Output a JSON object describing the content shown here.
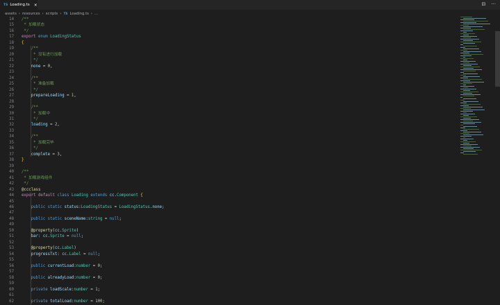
{
  "tab": {
    "badge": "TS",
    "label": "Loading.ts",
    "close": "×"
  },
  "actions": {
    "split": "⊟",
    "more": "···"
  },
  "breadcrumb": [
    "assets",
    "resources",
    "scripts"
  ],
  "breadcrumb_file": {
    "badge": "TS",
    "label": "Loading.ts",
    "more": "..."
  },
  "breadcrumb_sep": "›",
  "code": [
    {
      "n": "14",
      "t": [
        [
          "cm",
          "/**"
        ]
      ]
    },
    {
      "n": "15",
      "t": [
        [
          "cm",
          " * 加载状态"
        ]
      ]
    },
    {
      "n": "16",
      "t": [
        [
          "cm",
          " */"
        ]
      ]
    },
    {
      "n": "17",
      "t": [
        [
          "ctl",
          "export "
        ],
        [
          "kw",
          "enum "
        ],
        [
          "ty",
          "LoadingStatus"
        ]
      ]
    },
    {
      "n": "18",
      "t": [
        [
          "br",
          "{"
        ]
      ]
    },
    {
      "n": "19",
      "t": [
        [
          "cm",
          "    /**"
        ]
      ]
    },
    {
      "n": "20",
      "t": [
        [
          "cm",
          "     * 没有进行加载"
        ]
      ]
    },
    {
      "n": "21",
      "t": [
        [
          "cm",
          "     */"
        ]
      ]
    },
    {
      "n": "22",
      "t": [
        [
          "vr",
          "    none"
        ],
        [
          "pu",
          " = "
        ],
        [
          "nm",
          "0"
        ],
        [
          "pu",
          ","
        ]
      ]
    },
    {
      "n": "23",
      "t": []
    },
    {
      "n": "24",
      "t": [
        [
          "cm",
          "    /**"
        ]
      ]
    },
    {
      "n": "25",
      "t": [
        [
          "cm",
          "     * 准备加载"
        ]
      ]
    },
    {
      "n": "26",
      "t": [
        [
          "cm",
          "     */"
        ]
      ]
    },
    {
      "n": "27",
      "t": [
        [
          "vr",
          "    prepareLoading"
        ],
        [
          "pu",
          " = "
        ],
        [
          "nm",
          "1"
        ],
        [
          "pu",
          ","
        ]
      ]
    },
    {
      "n": "28",
      "t": []
    },
    {
      "n": "29",
      "t": [
        [
          "cm",
          "    /**"
        ]
      ]
    },
    {
      "n": "30",
      "t": [
        [
          "cm",
          "     * 加载中"
        ]
      ]
    },
    {
      "n": "31",
      "t": [
        [
          "cm",
          "     */"
        ]
      ]
    },
    {
      "n": "32",
      "t": [
        [
          "vr",
          "    loading"
        ],
        [
          "pu",
          " = "
        ],
        [
          "nm",
          "2"
        ],
        [
          "pu",
          ","
        ]
      ]
    },
    {
      "n": "33",
      "t": []
    },
    {
      "n": "34",
      "t": [
        [
          "cm",
          "    /**"
        ]
      ]
    },
    {
      "n": "35",
      "t": [
        [
          "cm",
          "     * 加载完毕"
        ]
      ]
    },
    {
      "n": "36",
      "t": [
        [
          "cm",
          "     */"
        ]
      ]
    },
    {
      "n": "37",
      "t": [
        [
          "vr",
          "    complete"
        ],
        [
          "pu",
          " = "
        ],
        [
          "nm",
          "3"
        ],
        [
          "pu",
          ","
        ]
      ]
    },
    {
      "n": "38",
      "t": [
        [
          "br",
          "}"
        ]
      ]
    },
    {
      "n": "39",
      "t": []
    },
    {
      "n": "40",
      "t": [
        [
          "cm",
          "/**"
        ]
      ]
    },
    {
      "n": "41",
      "t": [
        [
          "cm",
          " * 加载游戏组件"
        ]
      ]
    },
    {
      "n": "42",
      "t": [
        [
          "cm",
          " */"
        ]
      ]
    },
    {
      "n": "43",
      "t": [
        [
          "fn",
          "@ccclass"
        ]
      ]
    },
    {
      "n": "44",
      "t": [
        [
          "ctl",
          "export "
        ],
        [
          "ctl",
          "default "
        ],
        [
          "kw",
          "class "
        ],
        [
          "ty",
          "Loading "
        ],
        [
          "kw",
          "extends "
        ],
        [
          "vr",
          "cc"
        ],
        [
          "pu",
          "."
        ],
        [
          "ty",
          "Component "
        ],
        [
          "br",
          "{"
        ]
      ]
    },
    {
      "n": "45",
      "t": []
    },
    {
      "n": "46",
      "t": [
        [
          "kw",
          "    public static "
        ],
        [
          "vr",
          "status"
        ],
        [
          "pu",
          ":"
        ],
        [
          "ty",
          "LoadingStatus"
        ],
        [
          "pu",
          " = "
        ],
        [
          "ty",
          "LoadingStatus"
        ],
        [
          "pu",
          "."
        ],
        [
          "vr",
          "none"
        ],
        [
          "pu",
          ";"
        ]
      ]
    },
    {
      "n": "47",
      "t": []
    },
    {
      "n": "48",
      "t": [
        [
          "kw",
          "    public static "
        ],
        [
          "vr",
          "sceneName"
        ],
        [
          "pu",
          ":"
        ],
        [
          "ty",
          "string"
        ],
        [
          "pu",
          " = "
        ],
        [
          "kw",
          "null"
        ],
        [
          "pu",
          ";"
        ]
      ]
    },
    {
      "n": "49",
      "t": []
    },
    {
      "n": "50",
      "t": [
        [
          "fn",
          "    @property"
        ],
        [
          "pu",
          "("
        ],
        [
          "vr",
          "cc"
        ],
        [
          "pu",
          "."
        ],
        [
          "ty",
          "Sprite"
        ],
        [
          "pu",
          ")"
        ]
      ]
    },
    {
      "n": "51",
      "t": [
        [
          "vr",
          "    bar"
        ],
        [
          "pu",
          ": "
        ],
        [
          "vr",
          "cc"
        ],
        [
          "pu",
          "."
        ],
        [
          "ty",
          "Sprite"
        ],
        [
          "pu",
          " = "
        ],
        [
          "kw",
          "null"
        ],
        [
          "pu",
          ";"
        ]
      ]
    },
    {
      "n": "52",
      "t": []
    },
    {
      "n": "53",
      "t": [
        [
          "fn",
          "    @property"
        ],
        [
          "pu",
          "("
        ],
        [
          "vr",
          "cc"
        ],
        [
          "pu",
          "."
        ],
        [
          "ty",
          "Label"
        ],
        [
          "pu",
          ")"
        ]
      ]
    },
    {
      "n": "54",
      "t": [
        [
          "vr",
          "    progressTxt"
        ],
        [
          "pu",
          ": "
        ],
        [
          "vr",
          "cc"
        ],
        [
          "pu",
          "."
        ],
        [
          "ty",
          "Label"
        ],
        [
          "pu",
          " = "
        ],
        [
          "kw",
          "null"
        ],
        [
          "pu",
          ";"
        ]
      ]
    },
    {
      "n": "55",
      "t": []
    },
    {
      "n": "56",
      "t": [
        [
          "kw",
          "    public "
        ],
        [
          "vr",
          "currentLoad"
        ],
        [
          "pu",
          ":"
        ],
        [
          "ty",
          "number"
        ],
        [
          "pu",
          " = "
        ],
        [
          "nm",
          "0"
        ],
        [
          "pu",
          ";"
        ]
      ]
    },
    {
      "n": "57",
      "t": []
    },
    {
      "n": "58",
      "t": [
        [
          "kw",
          "    public "
        ],
        [
          "vr",
          "alreadyLoad"
        ],
        [
          "pu",
          ":"
        ],
        [
          "ty",
          "number"
        ],
        [
          "pu",
          " = "
        ],
        [
          "nm",
          "0"
        ],
        [
          "pu",
          ";"
        ]
      ]
    },
    {
      "n": "59",
      "t": []
    },
    {
      "n": "60",
      "t": [
        [
          "kw",
          "    private "
        ],
        [
          "vr",
          "loadScale"
        ],
        [
          "pu",
          ":"
        ],
        [
          "ty",
          "number"
        ],
        [
          "pu",
          " = "
        ],
        [
          "nm",
          "1"
        ],
        [
          "pu",
          ";"
        ]
      ]
    },
    {
      "n": "61",
      "t": []
    },
    {
      "n": "62",
      "t": [
        [
          "kw",
          "    private "
        ],
        [
          "vr",
          "totalLoad"
        ],
        [
          "pu",
          ":"
        ],
        [
          "ty",
          "number"
        ],
        [
          "pu",
          " = "
        ],
        [
          "nm",
          "100"
        ],
        [
          "pu",
          ";"
        ]
      ]
    }
  ]
}
